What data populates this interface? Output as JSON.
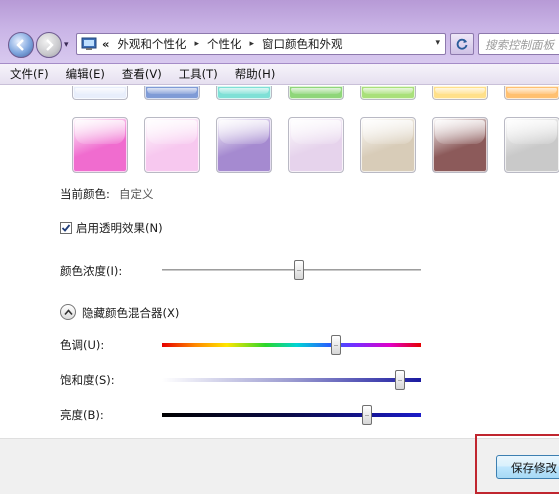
{
  "nav": {
    "dropdown_glyph": "▾",
    "back_icon": "back-arrow-icon",
    "forward_icon": "forward-arrow-icon"
  },
  "address": {
    "prefix": "«",
    "crumbs": [
      "外观和个性化",
      "个性化",
      "窗口颜色和外观"
    ],
    "separator": "▸",
    "dropdown_glyph": "▾"
  },
  "search": {
    "placeholder": "搜索控制面板"
  },
  "menu": {
    "items": [
      "文件(F)",
      "编辑(E)",
      "查看(V)",
      "工具(T)",
      "帮助(H)"
    ]
  },
  "colors": {
    "top_row": [
      "#e8eefb",
      "#7f9bd6",
      "#7fe0d6",
      "#8fd67a",
      "#a9e07a",
      "#ffe08a",
      "#ffc070"
    ],
    "bottom_row": [
      "#f06ccf",
      "#f7c8ef",
      "#a58ad0",
      "#e6d3ec",
      "#d8ccb8",
      "#8c5a5a",
      "#c9c9c9"
    ],
    "accent": "#c0262f"
  },
  "current_color": {
    "label": "当前颜色:",
    "value": "自定义"
  },
  "transparency": {
    "label": "启用透明效果(N)",
    "checked": true
  },
  "intensity": {
    "label": "颜色浓度(I):",
    "level": 0.53
  },
  "mixer": {
    "label": "隐藏颜色混合器(X)"
  },
  "hue": {
    "label": "色调(U):",
    "level": 0.67
  },
  "saturation": {
    "label": "饱和度(S):",
    "level": 0.92
  },
  "brightness": {
    "label": "亮度(B):",
    "level": 0.79
  },
  "footer": {
    "save_label": "保存修改"
  }
}
